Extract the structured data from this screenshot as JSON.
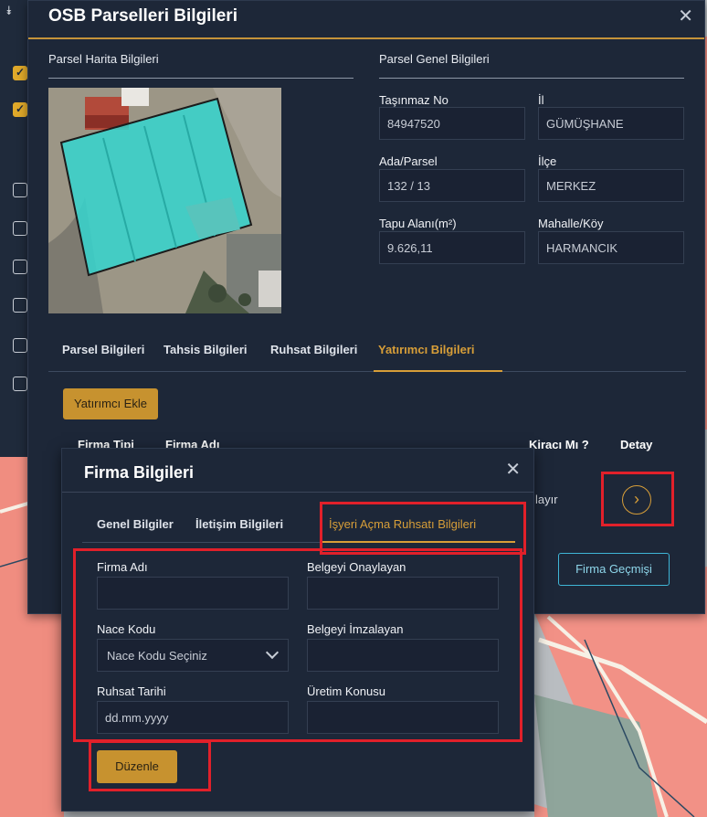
{
  "colors": {
    "accent": "#d79e38",
    "dialog_bg": "#1d2738",
    "field_bg": "#1a2233",
    "button_gold": "#c7922f",
    "outline_button": "#3fb5d6",
    "annotation_red": "#e1202a"
  },
  "main_dialog": {
    "title": "OSB Parselleri Bilgileri",
    "close_icon": "close-icon",
    "map_section_title": "Parsel Harita Bilgileri",
    "general_section_title": "Parsel Genel Bilgileri",
    "fields": {
      "tasinmaz_no": {
        "label": "Taşınmaz No",
        "value": "84947520"
      },
      "il": {
        "label": "İl",
        "value": "GÜMÜŞHANE"
      },
      "ada_parsel": {
        "label": "Ada/Parsel",
        "value": "132 / 13"
      },
      "ilce": {
        "label": "İlçe",
        "value": "MERKEZ"
      },
      "tapu_alani": {
        "label": "Tapu Alanı(m²)",
        "value": "9.626,11"
      },
      "mahalle_koy": {
        "label": "Mahalle/Köy",
        "value": "HARMANCIK"
      }
    },
    "tabs": [
      {
        "label": "Parsel Bilgileri"
      },
      {
        "label": "Tahsis Bilgileri"
      },
      {
        "label": "Ruhsat Bilgileri"
      },
      {
        "label": "Yatırımcı Bilgileri",
        "active": true
      }
    ],
    "add_investor_button": "Yatırımcı Ekle",
    "table_headers": {
      "firma_tipi": "Firma Tipi",
      "firma_adi": "Firma Adı",
      "kiraci_mi": "Kiracı Mı ?",
      "detay": "Detay"
    },
    "row_kiraci_value_partial": "layır",
    "detail_icon": "chevron-right-circle-icon",
    "history_button": "Firma Geçmişi"
  },
  "firma_dialog": {
    "title": "Firma Bilgileri",
    "close_icon": "close-icon",
    "tabs": [
      {
        "label": "Genel Bilgiler"
      },
      {
        "label": "İletişim Bilgileri"
      },
      {
        "label": "İşyeri Açma Ruhsatı Bilgileri",
        "active": true
      }
    ],
    "fields": {
      "firma_adi": {
        "label": "Firma Adı",
        "value": ""
      },
      "belgeyi_onaylayan": {
        "label": "Belgeyi Onaylayan",
        "value": ""
      },
      "nace_kodu": {
        "label": "Nace Kodu",
        "placeholder": "Nace Kodu Seçiniz"
      },
      "belgeyi_imzalayan": {
        "label": "Belgeyi İmzalayan",
        "value": ""
      },
      "ruhsat_tarihi": {
        "label": "Ruhsat Tarihi",
        "placeholder": "dd.mm.yyyy"
      },
      "uretim_konusu": {
        "label": "Üretim Konusu",
        "value": ""
      }
    },
    "edit_button": "Düzenle"
  }
}
